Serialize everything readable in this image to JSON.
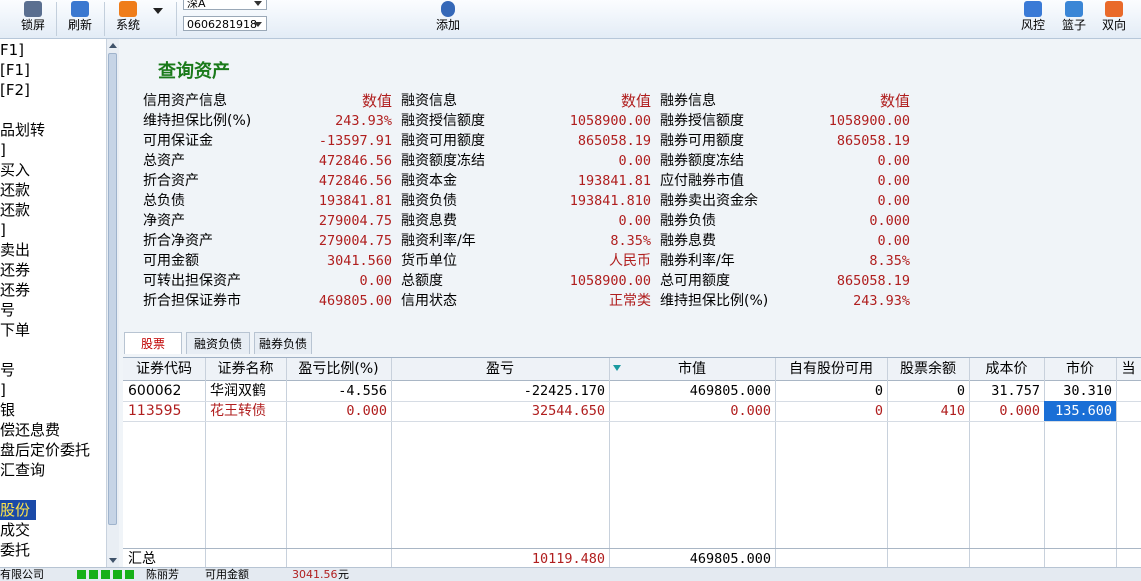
{
  "toolbar": {
    "lock": "锁屏",
    "refresh": "刷新",
    "system": "系统",
    "market_select": "深A",
    "account_select": "0606281918",
    "add": "添加",
    "risk": "风控",
    "basket": "篮子",
    "bidirectional": "双向"
  },
  "sidebar": {
    "items": [
      "F1]",
      "[F1]",
      "[F2]",
      "",
      "品划转",
      "]",
      "买入",
      "还款",
      "还款",
      "]",
      "卖出",
      "还券",
      "还券",
      "号",
      "下单",
      "",
      "号",
      "]",
      "银",
      "偿还息费",
      "盘后定价委托",
      "汇查询",
      "",
      "股份",
      "成交",
      "委托"
    ],
    "selected_index": 23
  },
  "main": {
    "title": "查询资产",
    "sections": [
      {
        "header": "信用资产信息",
        "value_header": "数值",
        "rows": [
          [
            "维持担保比例(%)",
            "243.93%"
          ],
          [
            "可用保证金",
            "-13597.91"
          ],
          [
            "总资产",
            "472846.56"
          ],
          [
            "折合资产",
            "472846.56"
          ],
          [
            "总负债",
            "193841.81"
          ],
          [
            "净资产",
            "279004.75"
          ],
          [
            "折合净资产",
            "279004.75"
          ],
          [
            "可用金额",
            "3041.560"
          ],
          [
            "可转出担保资产",
            "0.00"
          ],
          [
            "折合担保证券市",
            "469805.00"
          ]
        ]
      },
      {
        "header": "融资信息",
        "value_header": "数值",
        "rows": [
          [
            "融资授信额度",
            "1058900.00"
          ],
          [
            "融资可用额度",
            "865058.19"
          ],
          [
            "融资额度冻结",
            "0.00"
          ],
          [
            "融资本金",
            "193841.81"
          ],
          [
            "融资负债",
            "193841.810"
          ],
          [
            "融资息费",
            "0.00"
          ],
          [
            "融资利率/年",
            "8.35%"
          ],
          [
            "货币单位",
            "人民币"
          ],
          [
            "总额度",
            "1058900.00"
          ],
          [
            "信用状态",
            "正常类"
          ]
        ]
      },
      {
        "header": "融券信息",
        "value_header": "数值",
        "rows": [
          [
            "融券授信额度",
            "1058900.00"
          ],
          [
            "融券可用额度",
            "865058.19"
          ],
          [
            "融券额度冻结",
            "0.00"
          ],
          [
            "应付融券市值",
            "0.00"
          ],
          [
            "融券卖出资金余",
            "0.00"
          ],
          [
            "融券负债",
            "0.000"
          ],
          [
            "融券息费",
            "0.00"
          ],
          [
            "融券利率/年",
            "8.35%"
          ],
          [
            "总可用额度",
            "865058.19"
          ],
          [
            "维持担保比例(%)",
            "243.93%"
          ]
        ]
      }
    ],
    "tabs": [
      "股票",
      "融资负债",
      "融券负债"
    ],
    "active_tab": 0
  },
  "grid": {
    "columns": [
      "证券代码",
      "证券名称",
      "盈亏比例(%)",
      "盈亏",
      "市值",
      "自有股份可用",
      "股票余额",
      "成本价",
      "市价",
      "当"
    ],
    "rows": [
      [
        "600062",
        "华润双鹤",
        "-4.556",
        "-22425.170",
        "469805.000",
        "0",
        "0",
        "31.757",
        "30.310",
        ""
      ],
      [
        "113595",
        "花王转债",
        "0.000",
        "32544.650",
        "0.000",
        "0",
        "410",
        "0.000",
        "135.600",
        ""
      ]
    ],
    "summary_label": "汇总",
    "summary_pnl": "10119.480",
    "summary_value": "469805.000"
  },
  "status": {
    "company": "有限公司",
    "user": "陈丽芳",
    "avail_label": "可用金额",
    "avail_value": "3041.56",
    "unit": "元"
  },
  "colors": {
    "value_red": "#b01e1e",
    "title_green": "#1a7a1a",
    "selection_blue": "#1a6fd6",
    "row2_text": "#b01e1e"
  }
}
